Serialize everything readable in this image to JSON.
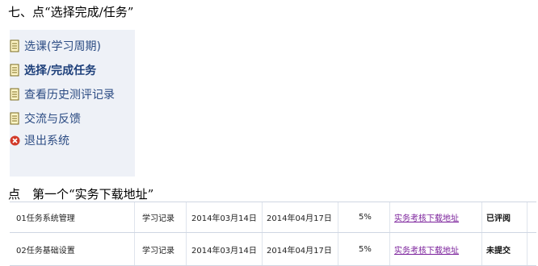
{
  "doc": {
    "heading1": "七、点“选择完成/任务”",
    "heading2": "点　第一个“实务下载地址”"
  },
  "menu": {
    "items": [
      {
        "label": "选课(学习周期)",
        "icon": "document-icon"
      },
      {
        "label": "选择/完成任务",
        "icon": "document-icon",
        "active": true
      },
      {
        "label": "查看历史测评记录",
        "icon": "document-icon"
      },
      {
        "label": "交流与反馈",
        "icon": "document-icon"
      },
      {
        "label": "退出系统",
        "icon": "close-icon"
      }
    ]
  },
  "tasks": {
    "rows": [
      {
        "name": "01任务系统管理",
        "type": "学习记录",
        "start": "2014年03月14日",
        "end": "2014年04月17日",
        "percent": "5%",
        "link": "实务考核下载地址",
        "status": "已评阅"
      },
      {
        "name": "02任务基础设置",
        "type": "学习记录",
        "start": "2014年03月14日",
        "end": "2014年04月17日",
        "percent": "5%",
        "link": "实务考核下载地址",
        "status": "未提交"
      }
    ]
  },
  "colors": {
    "menu_bg": "#eef1f7",
    "menu_text": "#2b4b83",
    "link": "#7a1f9a",
    "exit_icon": "#d23a2a"
  }
}
